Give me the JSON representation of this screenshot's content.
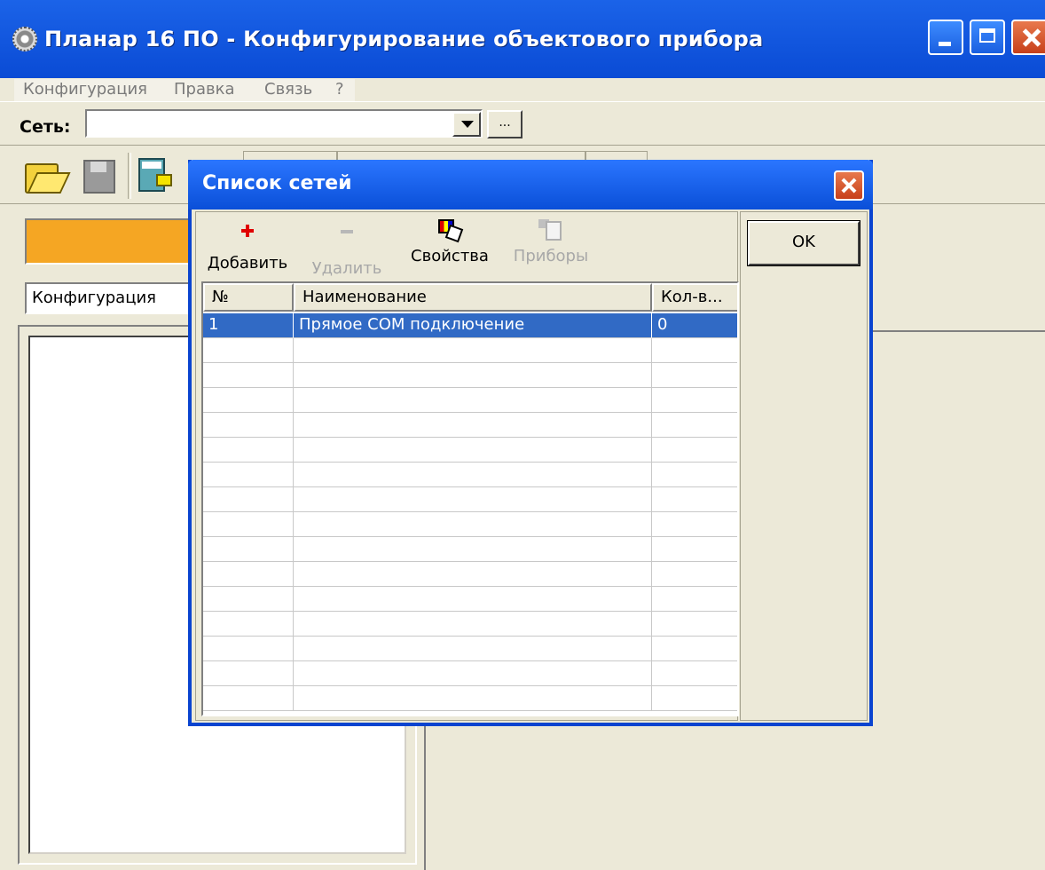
{
  "window": {
    "title": "Планар 16 ПО - Конфигурирование объектового прибора"
  },
  "menu": [
    "Конфигурация",
    "Правка",
    "Связь",
    "?"
  ],
  "network": {
    "label": "Сеть:",
    "value": "",
    "browse_label": "..."
  },
  "left_panel": {
    "config_label": "Конфигурация"
  },
  "dialog": {
    "title": "Список сетей",
    "tools": [
      {
        "label": "Добавить",
        "icon": "plus-icon",
        "enabled": true
      },
      {
        "label": "Удалить",
        "icon": "minus-icon",
        "enabled": false
      },
      {
        "label": "Свойства",
        "icon": "properties-icon",
        "enabled": true
      },
      {
        "label": "Приборы",
        "icon": "devices-icon",
        "enabled": false
      }
    ],
    "columns": [
      "№",
      "Наименование",
      "Кол-в..."
    ],
    "rows": [
      {
        "num": "1",
        "name": "Прямое COM подключение",
        "count": "0",
        "selected": true
      }
    ],
    "ok_label": "OK"
  },
  "colors": {
    "title_blue": "#0a4bd5",
    "selection": "#316ac5",
    "orange": "#f5a623",
    "face": "#ece9d8"
  }
}
